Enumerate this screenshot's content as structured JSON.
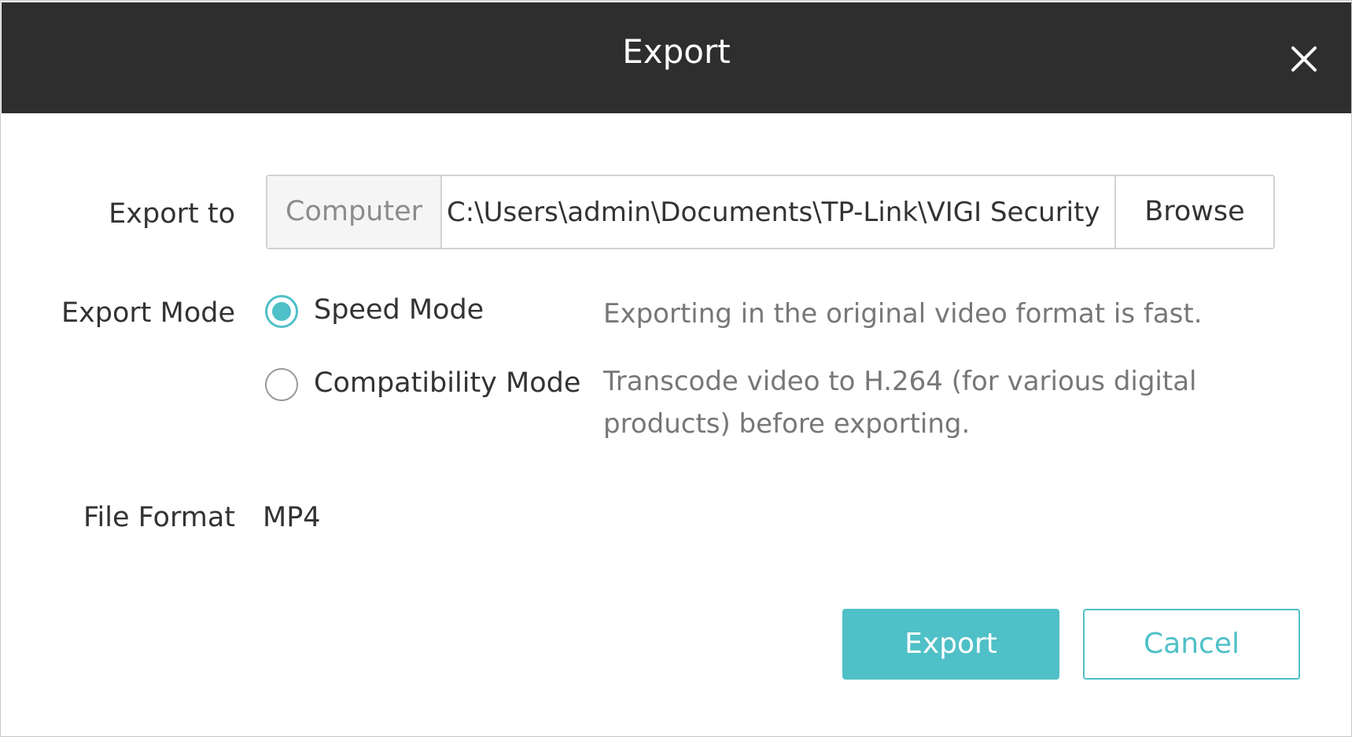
{
  "dialog": {
    "title": "Export",
    "close_icon": "close-icon"
  },
  "export_to": {
    "label": "Export to",
    "location": "Computer",
    "path": "C:\\Users\\admin\\Documents\\TP-Link\\VIGI Security",
    "browse_label": "Browse"
  },
  "export_mode": {
    "label": "Export Mode",
    "options": [
      {
        "label": "Speed Mode",
        "selected": true,
        "description": "Exporting in the original video format is fast."
      },
      {
        "label": "Compatibility Mode",
        "selected": false,
        "description": "Transcode video to H.264 (for various digital products) before exporting."
      }
    ]
  },
  "file_format": {
    "label": "File Format",
    "value": "MP4"
  },
  "footer": {
    "export_label": "Export",
    "cancel_label": "Cancel"
  },
  "colors": {
    "header_bg": "#2e2e2e",
    "accent": "#4fc0c7"
  }
}
